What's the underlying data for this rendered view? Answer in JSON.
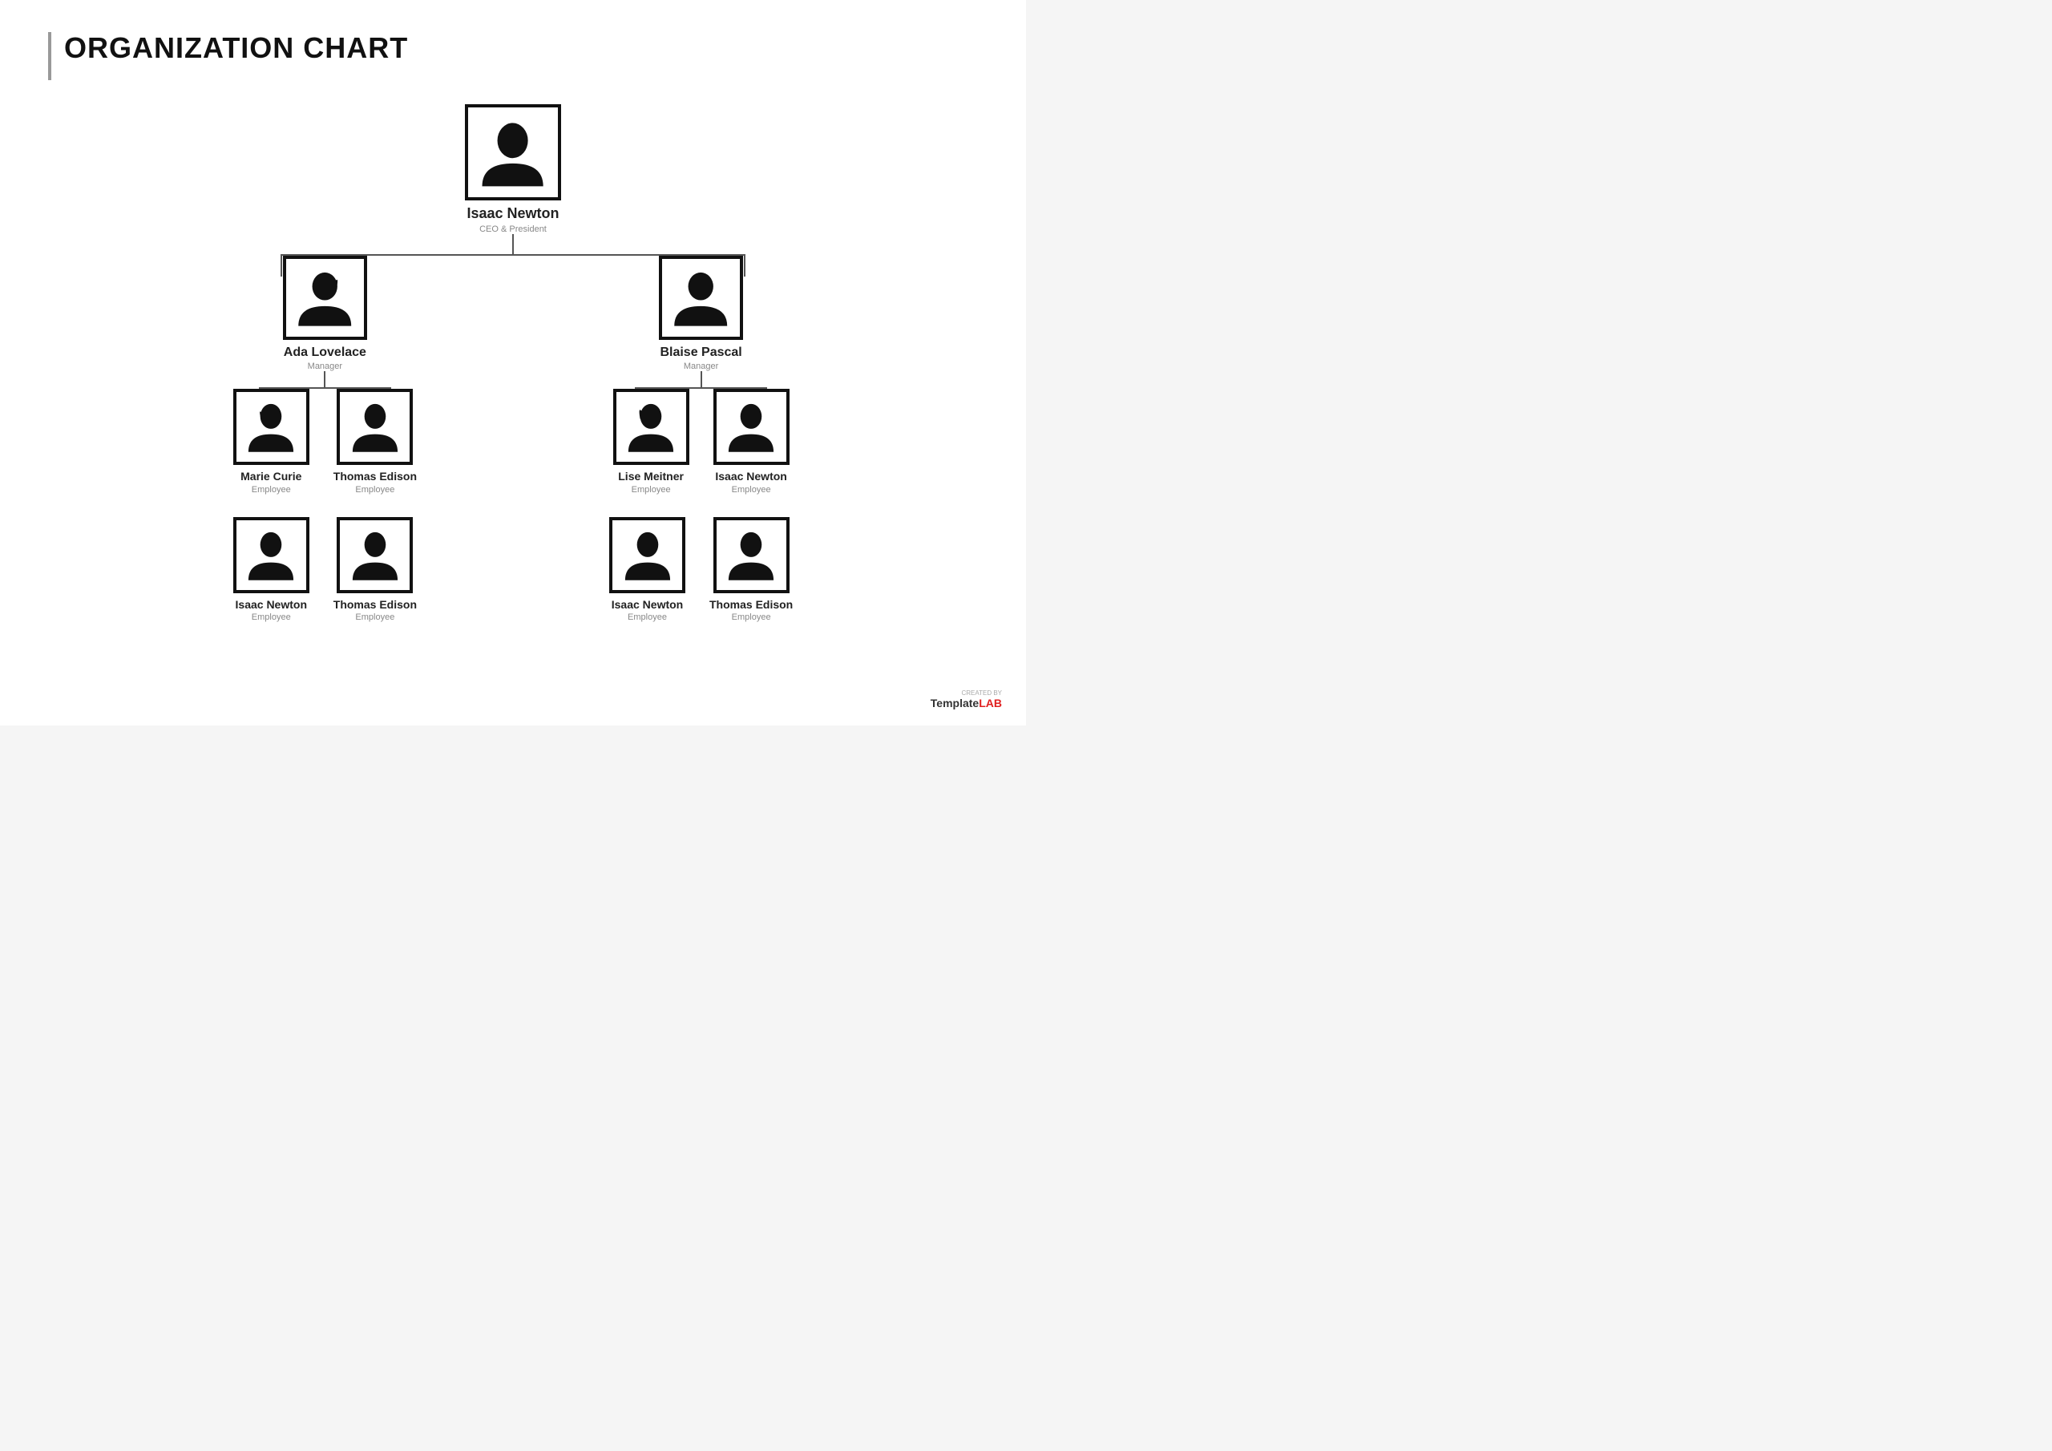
{
  "page": {
    "title": "ORGANIZATION CHART"
  },
  "chart": {
    "ceo": {
      "name": "Isaac Newton",
      "title": "CEO & President",
      "gender": "male"
    },
    "managers": [
      {
        "name": "Ada Lovelace",
        "title": "Manager",
        "gender": "female",
        "employees_row1": [
          {
            "name": "Marie Curie",
            "title": "Employee",
            "gender": "female"
          },
          {
            "name": "Thomas Edison",
            "title": "Employee",
            "gender": "male"
          }
        ],
        "employees_row2": [
          {
            "name": "Isaac Newton",
            "title": "Employee",
            "gender": "male"
          },
          {
            "name": "Thomas Edison",
            "title": "Employee",
            "gender": "male"
          }
        ]
      },
      {
        "name": "Blaise Pascal",
        "title": "Manager",
        "gender": "male",
        "employees_row1": [
          {
            "name": "Lise Meitner",
            "title": "Employee",
            "gender": "female"
          },
          {
            "name": "Isaac Newton",
            "title": "Employee",
            "gender": "male"
          }
        ],
        "employees_row2": [
          {
            "name": "Isaac Newton",
            "title": "Employee",
            "gender": "male"
          },
          {
            "name": "Thomas Edison",
            "title": "Employee",
            "gender": "male"
          }
        ]
      }
    ]
  },
  "footer": {
    "created_by": "CREATED BY",
    "brand": "TemplateLAB"
  }
}
